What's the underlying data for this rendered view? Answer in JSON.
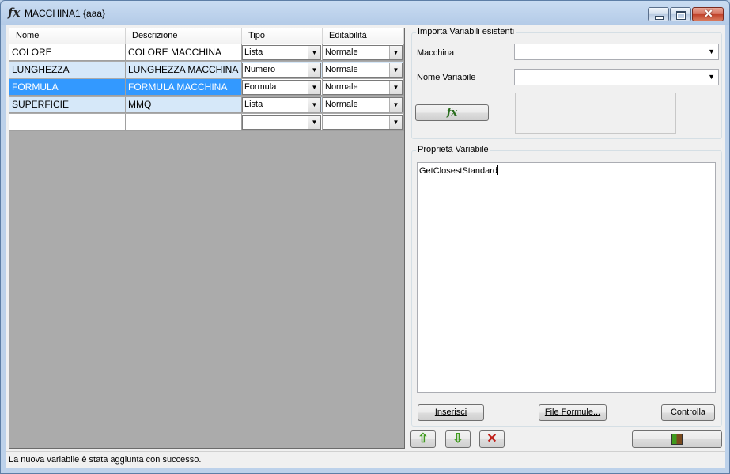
{
  "window": {
    "icon": "fx-icon",
    "title": "MACCHINA1 {aaa}"
  },
  "grid": {
    "headers": [
      "Nome",
      "Descrizione",
      "Tipo",
      "Editabilità"
    ],
    "rows": [
      {
        "nome": "COLORE",
        "descrizione": "COLORE MACCHINA",
        "tipo": "Lista",
        "editabilita": "Normale",
        "style": "normal"
      },
      {
        "nome": "LUNGHEZZA",
        "descrizione": "LUNGHEZZA MACCHINA",
        "tipo": "Numero",
        "editabilita": "Normale",
        "style": "alt"
      },
      {
        "nome": "FORMULA",
        "descrizione": "FORMULA MACCHINA",
        "tipo": "Formula",
        "editabilita": "Normale",
        "style": "selected"
      },
      {
        "nome": "SUPERFICIE",
        "descrizione": "MMQ",
        "tipo": "Lista",
        "editabilita": "Normale",
        "style": "alt"
      },
      {
        "nome": "",
        "descrizione": "",
        "tipo": "",
        "editabilita": "",
        "style": "normal"
      }
    ]
  },
  "import_group": {
    "title": "Importa Variabili esistenti",
    "macchina_label": "Macchina",
    "macchina_value": "",
    "nome_variabile_label": "Nome Variabile",
    "nome_variabile_value": "",
    "fx_button_label": "fx"
  },
  "properties_group": {
    "title": "Proprietà Variabile",
    "text": "GetClosestStandard",
    "inserisci_label": "Inserisci",
    "file_formule_label": "File Formule...",
    "controlla_label": "Controlla"
  },
  "actions": {
    "up_icon": "arrow-up-icon",
    "down_icon": "arrow-down-icon",
    "delete_icon": "delete-x-icon",
    "exit_icon": "exit-door-icon"
  },
  "status_bar": {
    "text": "La nuova variabile è stata aggiunta con successo."
  },
  "colors": {
    "selection": "#3399ff",
    "alt_row": "#d6e8f9",
    "grid_bg": "#ababab"
  }
}
